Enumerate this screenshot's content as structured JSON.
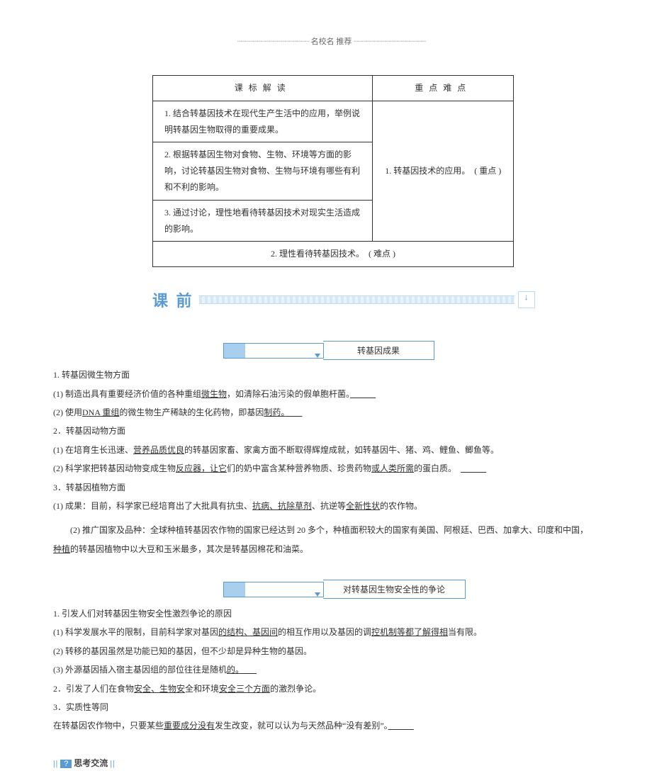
{
  "header": {
    "dots_left": "┄┄┄┄┄┄┄┄┄┄┄┄┄┄┄┄┄┄",
    "title": "名校名 推荐",
    "dots_right": "┄┄┄┄┄┄┄┄┄┄┄┄┄┄┄┄┄┄"
  },
  "table": {
    "col1_header": "课标解读",
    "col2_header": "重点难点",
    "row1": "1. 结合转基因技术在现代生产生活中的应用，举例说明转基因生物取得的重要成果。",
    "row2": "2. 根据转基因生物对食物、生物、环境等方面的影响，讨论转基因生物对食物、生物与环境有哪些有利和不利的影响。",
    "row3": "3. 通过讨论，理性地看待转基因技术对现实生活造成的影响。",
    "row4": "2. 理性看待转基因技术。　( 难点 )",
    "right_content": "1. 转基因技术的应用。　( 重点 )"
  },
  "section_before": "课 前",
  "topic1": {
    "label": "转基因成果",
    "h1": "1. 转基因微生物方面",
    "l1a": "(1) 制造出具有重要经济价值的各种重组",
    "l1b": "微生物",
    "l1c": "，如清除石油污染的假单胞杆菌。",
    "l2a": "(2) 使用",
    "l2b": "DNA 重组",
    "l2c": "的微生物生产稀缺的生化药物，即基因",
    "l2d": "制药。",
    "h2": "2．转基因动物方面",
    "l3a": "(1) 在培育生长迅速、",
    "l3b": "营养品质优良",
    "l3c": "的转基因家畜、家禽方面不断取得辉煌成就，如转基因牛、猪、鸡、鲤鱼、鲫鱼等。",
    "l4a": "(2) 科学家把转基因动物变成生物",
    "l4b": "反应器，让它",
    "l4c": "们的奶中富含某种营养物质、珍贵药物",
    "l4d": "或人类所需",
    "l4e": "的蛋白质。",
    "h3": "3．转基因植物方面",
    "l5a": "(1) 成果：目前，科学家已经培育出了大批具有抗虫、",
    "l5b": "抗病、抗除草剂",
    "l5c": "、抗逆等",
    "l5d": "全新性状",
    "l5e": "的农作物。",
    "l6a": "(2) 推广国家及品种：全球种植转基因农作物的国家已经达到 20 多个，种植面积较大的国家有美国、阿根廷、巴西、加拿大、印度和中国，",
    "l6b": "种植",
    "l6c": "的转基因植物中以大豆和玉米最多，其次是转基因棉花和油菜。"
  },
  "topic2": {
    "label": "对转基因生物安全性的争论",
    "h1": "1. 引发人们对转基因生物安全性激烈争论的原因",
    "l1a": "(1) 科学发展水平的限制，目前科学家对基因",
    "l1b": "的结构、基因间",
    "l1c": "的相互作用以及基因的调",
    "l1d": "控机制等都了解得相",
    "l1e": "当有限。",
    "l2": "(2) 转移的基因虽然是功能已知的基因，但不少却是异种生物的基因。",
    "l3a": "(3) 外源基因插入宿主基因组的部位往往是随机",
    "l3b": "的。",
    "l4a": "2．引发了人们在食物",
    "l4b": "安全、生物安",
    "l4c": "全和环境",
    "l4d": "安全三个方面",
    "l4e": "的激烈争论。",
    "h3": "3．实质性等同",
    "l5a": "在转基因农作物中，只要某些",
    "l5b": "重要成分没有",
    "l5c": "发生改变，就可以认为与天然品种“没有差别”。"
  },
  "footer": {
    "num": "?",
    "text": "思考交流"
  }
}
